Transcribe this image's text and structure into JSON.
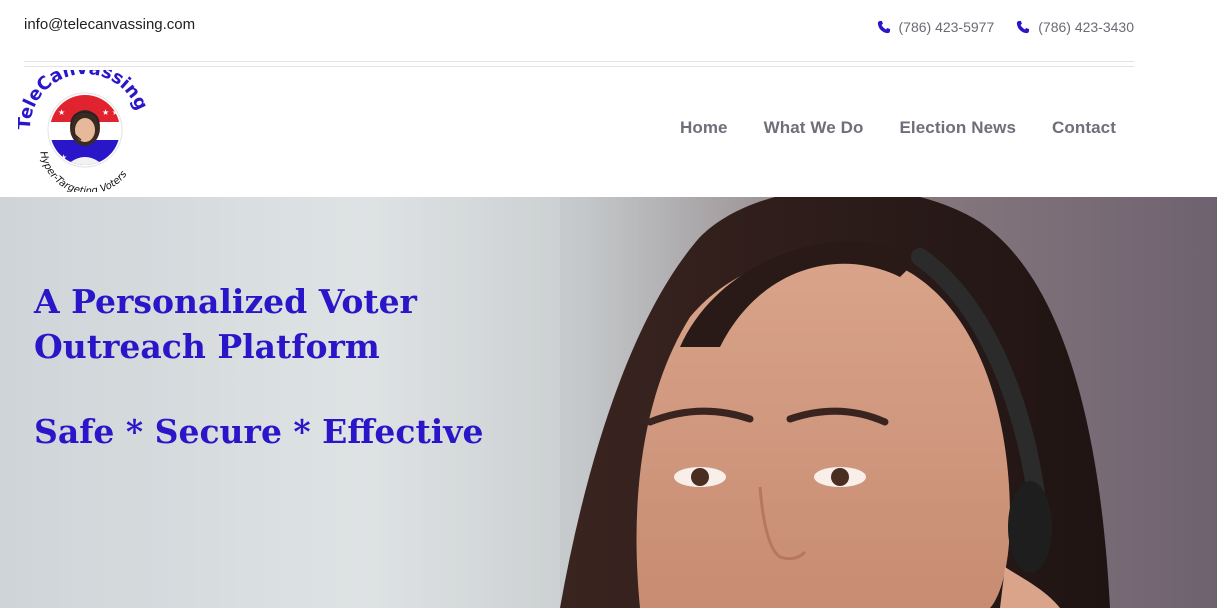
{
  "topbar": {
    "email": "info@telecanvassing.com",
    "phones": [
      "(786) 423-5977",
      "(786) 423-3430"
    ]
  },
  "logo": {
    "brand": "TeleCanvassing",
    "tagline": "Hyper-Targeting Voters"
  },
  "nav": {
    "items": [
      "Home",
      "What We Do",
      "Election News",
      "Contact"
    ]
  },
  "hero": {
    "title": "A Personalized Voter Outreach Platform",
    "tagline": "Safe * Secure * Effective"
  },
  "colors": {
    "accent": "#2a16c9",
    "nav_text": "#6e6f7a",
    "logo_red": "#e0232e"
  }
}
